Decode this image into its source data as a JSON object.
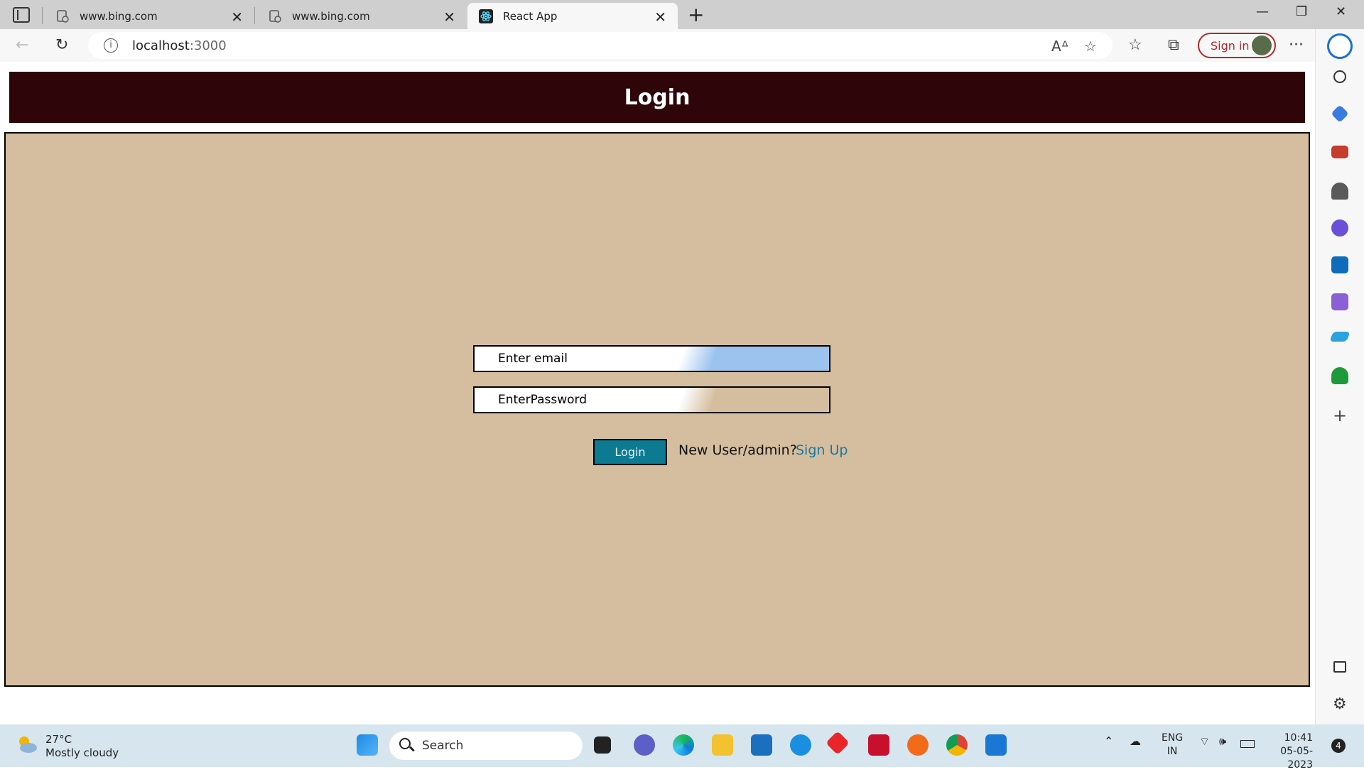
{
  "browser": {
    "tabs": [
      {
        "label": "www.bing.com",
        "active": false
      },
      {
        "label": "www.bing.com",
        "active": false
      },
      {
        "label": "React App",
        "active": true
      }
    ],
    "address": {
      "host": "localhost",
      "port": ":3000"
    },
    "signin_label": "Sign in"
  },
  "page": {
    "header_title": "Login",
    "email_placeholder": "Enter email",
    "password_placeholder": "EnterPassword",
    "login_button": "Login",
    "new_user_text": "New User/admin?",
    "signup_link": "Sign Up"
  },
  "colors": {
    "header_bg": "#2e0508",
    "panel_bg": "#d5be9f",
    "button_bg": "#0d7a93",
    "link": "#1678a0"
  },
  "taskbar": {
    "weather_temp": "27°C",
    "weather_desc": "Mostly cloudy",
    "search_label": "Search",
    "lang_line1": "ENG",
    "lang_line2": "IN",
    "time": "10:41",
    "date": "05-05-2023",
    "notification_count": "4"
  },
  "icons": [
    "tab-actions-icon",
    "page-favicon-icon",
    "react-icon",
    "close-icon",
    "new-tab-icon",
    "minimize-icon",
    "restore-icon",
    "window-close-icon",
    "back-icon",
    "refresh-icon",
    "info-icon",
    "read-aloud-icon",
    "add-favorite-icon",
    "favorites-icon",
    "collections-icon",
    "more-icon",
    "bing-icon",
    "search-icon",
    "shopping-icon",
    "tools-icon",
    "games-icon",
    "office-icon",
    "outlook-icon",
    "designer-icon",
    "drop-icon",
    "tree-icon",
    "add-icon",
    "sidebar-toggle-icon",
    "settings-icon"
  ]
}
